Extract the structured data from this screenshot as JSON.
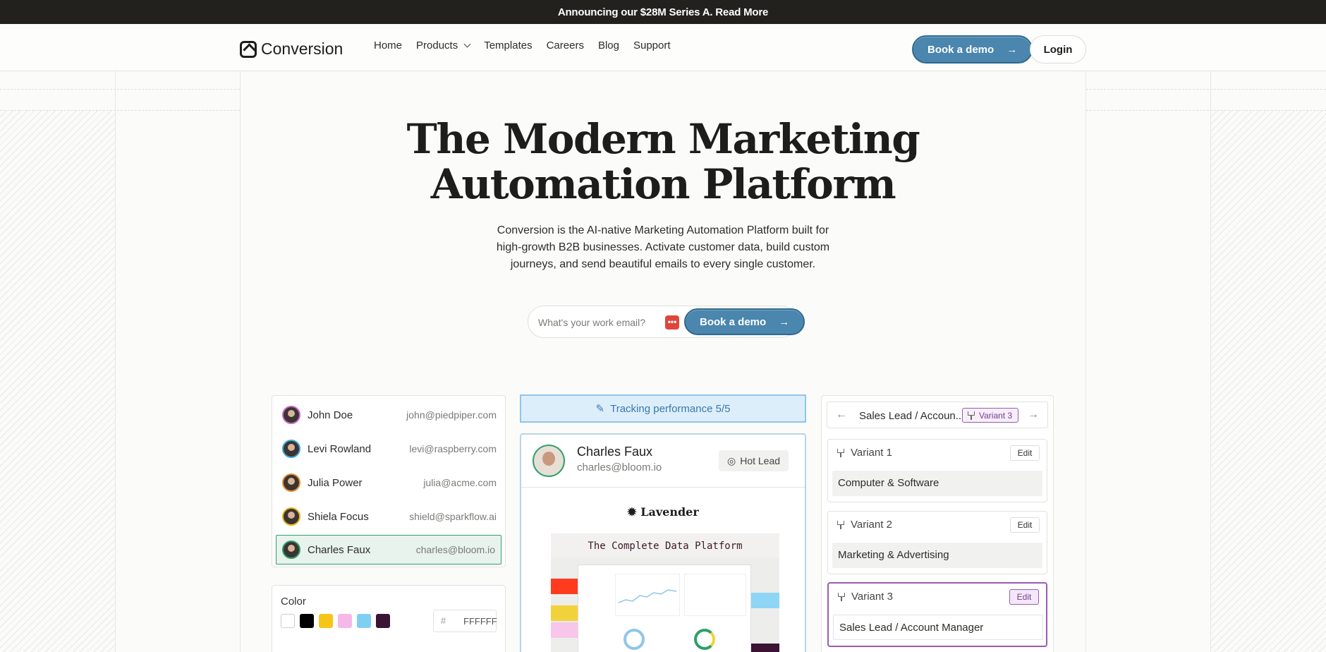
{
  "announcement": "Announcing our $28M Series A. Read More",
  "brand": "Conversion",
  "nav": {
    "links": [
      "Home",
      "Products",
      "Templates",
      "Careers",
      "Blog",
      "Support"
    ],
    "demo_label": "Book a demo",
    "login_label": "Login"
  },
  "hero": {
    "title_line1": "The Modern Marketing",
    "title_line2": "Automation Platform",
    "subtitle_line1": "Conversion is the AI-native Marketing Automation Platform built for",
    "subtitle_line2": "high-growth B2B businesses. Activate customer data, build custom",
    "subtitle_line3": "journeys, and send beautiful emails to every single customer.",
    "email_placeholder": "What's your work email?",
    "cta_label": "Book a demo"
  },
  "contacts": [
    {
      "name": "John Doe",
      "email": "john@piedpiper.com",
      "ring": "#c868c9"
    },
    {
      "name": "Levi Rowland",
      "email": "levi@raspberry.com",
      "ring": "#3aa6e0"
    },
    {
      "name": "Julia Power",
      "email": "julia@acme.com",
      "ring": "#e98a2e"
    },
    {
      "name": "Shiela Focus",
      "email": "shield@sparkflow.ai",
      "ring": "#e8b619"
    },
    {
      "name": "Charles Faux",
      "email": "charles@bloom.io",
      "ring": "#2e9f6b"
    }
  ],
  "color_panel": {
    "label": "Color",
    "swatches": [
      "#ffffff",
      "#000000",
      "#f5c518",
      "#f6b8e8",
      "#7fcff2",
      "#3a1335"
    ],
    "hash": "#",
    "hex_value": "FFFFFF"
  },
  "tracking": {
    "label": "Tracking performance 5/5"
  },
  "lead": {
    "name": "Charles Faux",
    "email": "charles@bloom.io",
    "badge": "Hot Lead",
    "company": "Lavender",
    "email_heading": "The Complete Data Platform"
  },
  "variants_panel": {
    "header": "Sales Lead / Accoun...",
    "header_tag": "Variant 3",
    "edit_label": "Edit",
    "items": [
      {
        "title": "Variant 1",
        "value": "Computer & Software"
      },
      {
        "title": "Variant 2",
        "value": "Marketing & Advertising"
      },
      {
        "title": "Variant 3",
        "value": "Sales Lead / Account Manager"
      }
    ]
  }
}
